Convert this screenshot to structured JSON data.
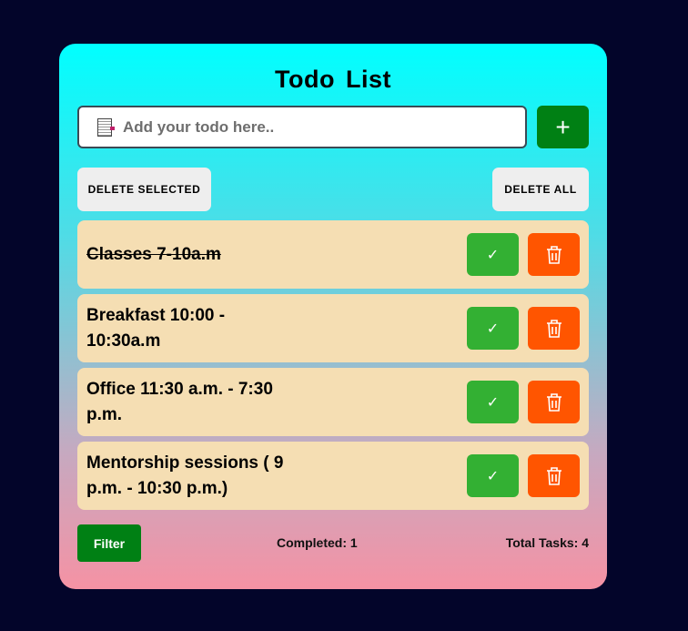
{
  "title": "Todo  List",
  "input": {
    "placeholder": "Add your todo here..",
    "value": ""
  },
  "add_label": "+",
  "delete_selected_label": "DELETE SELECTED",
  "delete_all_label": "DELETE ALL",
  "todos": [
    {
      "text": "Classes 7-10a.m",
      "completed": true
    },
    {
      "text": "Breakfast 10:00 - 10:30a.m",
      "completed": false
    },
    {
      "text": "Office 11:30 a.m. - 7:30 p.m.",
      "completed": false
    },
    {
      "text": "Mentorship sessions ( 9 p.m. - 10:30 p.m.)",
      "completed": false
    }
  ],
  "check_glyph": "✓",
  "filter_label": "Filter",
  "completed_text": "Completed: 1",
  "total_text": "Total Tasks: 4"
}
